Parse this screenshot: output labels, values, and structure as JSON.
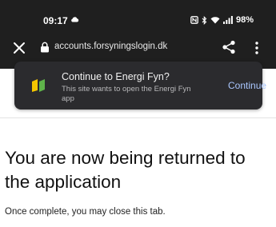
{
  "status_bar": {
    "time": "09:17",
    "battery": "98%",
    "icons": [
      "cloud-icon",
      "nfc-icon",
      "bluetooth-icon",
      "wifi-icon",
      "signal-icon"
    ]
  },
  "browser": {
    "url": "accounts.forsyningslogin.dk",
    "icons": [
      "close-icon",
      "lock-icon",
      "share-icon",
      "more-menu-icon"
    ]
  },
  "app_prompt": {
    "title": "Continue to Energi Fyn?",
    "subtitle": "This site wants to open the Energi Fyn app",
    "continue_label": "Continue",
    "logo_colors": [
      "#f4c600",
      "#5fb34a"
    ]
  },
  "page": {
    "heading": "You are now being returned to the application",
    "note": "Once complete, you may close this tab."
  }
}
